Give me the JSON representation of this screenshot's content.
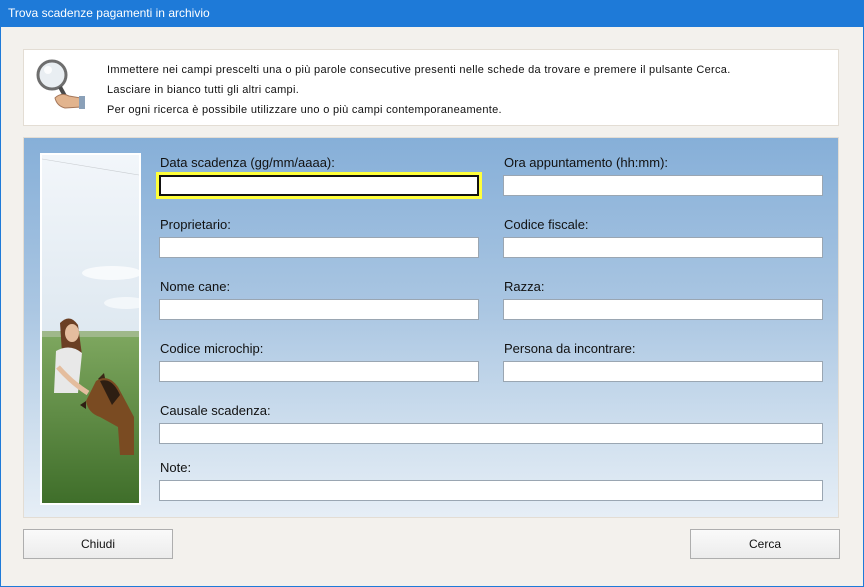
{
  "window": {
    "title": "Trova scadenze pagamenti in archivio"
  },
  "info": {
    "icon": "magnifier-hand-icon",
    "lines": [
      "Immettere nei campi prescelti una o più parole consecutive presenti nelle schede da trovare e premere il pulsante Cerca.",
      "Lasciare in bianco tutti gli altri campi.",
      "Per ogni ricerca è possibile utilizzare uno o più campi contemporaneamente."
    ]
  },
  "form": {
    "data_scadenza": {
      "label": "Data scadenza (gg/mm/aaaa):",
      "value": ""
    },
    "ora_appuntamento": {
      "label": "Ora appuntamento (hh:mm):",
      "value": ""
    },
    "proprietario": {
      "label": "Proprietario:",
      "value": ""
    },
    "codice_fiscale": {
      "label": "Codice fiscale:",
      "value": ""
    },
    "nome_cane": {
      "label": "Nome cane:",
      "value": ""
    },
    "razza": {
      "label": "Razza:",
      "value": ""
    },
    "codice_microchip": {
      "label": "Codice microchip:",
      "value": ""
    },
    "persona_incontrare": {
      "label": "Persona da incontrare:",
      "value": ""
    },
    "causale_scadenza": {
      "label": "Causale scadenza:",
      "value": ""
    },
    "note": {
      "label": "Note:",
      "value": ""
    }
  },
  "buttons": {
    "close_label": "Chiudi",
    "search_label": "Cerca"
  },
  "colors": {
    "titlebar": "#1e7ad8",
    "focus_highlight": "#ffff3a"
  }
}
